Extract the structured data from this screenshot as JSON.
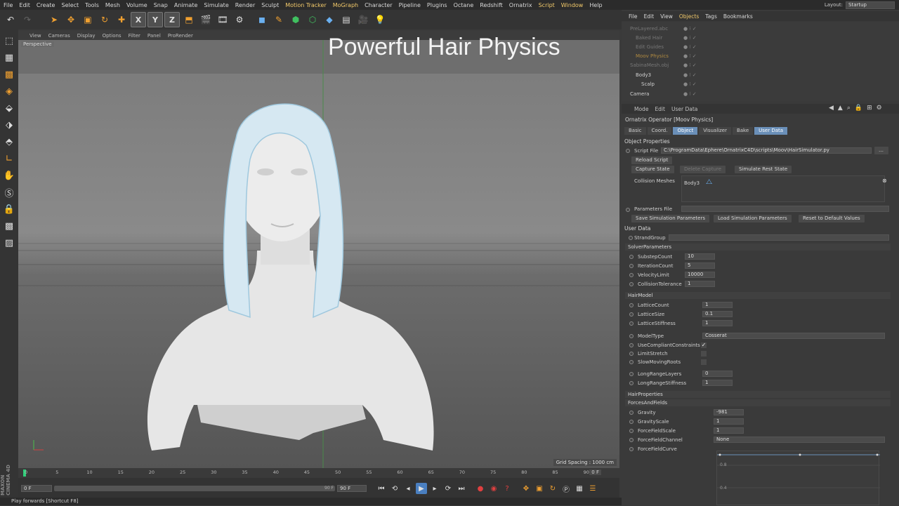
{
  "menubar": {
    "items": [
      "File",
      "Edit",
      "Create",
      "Select",
      "Tools",
      "Mesh",
      "Volume",
      "Snap",
      "Animate",
      "Simulate",
      "Render",
      "Sculpt",
      "Motion Tracker",
      "MoGraph",
      "Character",
      "Pipeline",
      "Plugins",
      "Octane",
      "Redshift",
      "Ornatrix",
      "Script",
      "Window",
      "Help"
    ],
    "highlighted": [
      "Motion Tracker",
      "MoGraph",
      "Script",
      "Window"
    ],
    "layout_label": "Layout:",
    "layout_value": "Startup"
  },
  "viewport": {
    "menu": [
      "View",
      "Cameras",
      "Display",
      "Options",
      "Filter",
      "Panel",
      "ProRender"
    ],
    "label": "Perspective",
    "overlay_title": "Powerful Hair Physics",
    "grid_spacing": "Grid Spacing : 1000 cm"
  },
  "timeline": {
    "ticks": [
      "0",
      "5",
      "10",
      "15",
      "20",
      "25",
      "30",
      "35",
      "40",
      "45",
      "50",
      "55",
      "60",
      "65",
      "70",
      "75",
      "80",
      "85",
      "90"
    ],
    "current_frame": "0 F",
    "start_field": "0 F",
    "end_field": "90 F",
    "end_field2": "90 F",
    "end_min": "0 F"
  },
  "status_text": "Play forwards [Shortcut F8]",
  "maxon_text": "MAXON CINEMA 4D",
  "object_manager": {
    "menu": [
      "File",
      "Edit",
      "View",
      "Objects",
      "Tags",
      "Bookmarks"
    ],
    "highlighted": [
      "Objects"
    ],
    "rows": [
      {
        "name": "PreLayered.abc",
        "indent": 0,
        "faded": true
      },
      {
        "name": "Baked Hair",
        "indent": 1,
        "faded": true
      },
      {
        "name": "Edit Guides",
        "indent": 1,
        "faded": true
      },
      {
        "name": "Moov Physics",
        "indent": 1,
        "faded": true,
        "accent": true
      },
      {
        "name": "SabinaMesh.obj",
        "indent": 0,
        "faded": true
      },
      {
        "name": "Body3",
        "indent": 1,
        "faded": false
      },
      {
        "name": "Scalp",
        "indent": 2,
        "faded": false
      },
      {
        "name": "Camera",
        "indent": 0,
        "faded": false
      }
    ]
  },
  "attribute_manager": {
    "menu": [
      "Mode",
      "Edit",
      "User Data"
    ],
    "title": "Ornatrix Operator [Moov Physics]",
    "tabs": [
      {
        "label": "Basic",
        "active": false
      },
      {
        "label": "Coord.",
        "active": false
      },
      {
        "label": "Object",
        "active": true
      },
      {
        "label": "Visualizer",
        "active": false
      },
      {
        "label": "Bake",
        "active": false
      },
      {
        "label": "User Data",
        "active": true
      }
    ],
    "object_properties": "Object Properties",
    "script_file_label": "Script File",
    "script_file_value": "C:\\ProgramData\\Ephere\\OrnatrixC4D\\scripts\\Moov\\HairSimulator.py",
    "reload_script": "Reload Script",
    "capture_state": "Capture State",
    "delete_capture": "Delete Capture",
    "simulate_rest_state": "Simulate Rest State",
    "collision_meshes_label": "Collision Meshes",
    "collision_meshes_value": "Body3",
    "parameters_file_label": "Parameters File",
    "save_sim_params": "Save Simulation Parameters",
    "load_sim_params": "Load Simulation Parameters",
    "reset_defaults": "Reset to Default Values",
    "user_data": "User Data",
    "strand_group": "StrandGroup",
    "solver_section": "SolverParameters",
    "solver": [
      {
        "label": "SubstepCount",
        "value": "10"
      },
      {
        "label": "IterationCount",
        "value": "5"
      },
      {
        "label": "VelocityLimit",
        "value": "10000"
      },
      {
        "label": "CollisionTolerance",
        "value": "1"
      }
    ],
    "hairmodel_section": "HairModel",
    "hairmodel": [
      {
        "label": "LatticeCount",
        "value": "1"
      },
      {
        "label": "LatticeSize",
        "value": "0.1"
      },
      {
        "label": "LatticeStiffness",
        "value": "1"
      }
    ],
    "model_type_label": "ModelType",
    "model_type_value": "Cosserat",
    "checks": [
      {
        "label": "UseCompliantConstraints",
        "checked": true
      },
      {
        "label": "LimitStretch",
        "checked": false
      },
      {
        "label": "SlowMovingRoots",
        "checked": false
      }
    ],
    "long_range": [
      {
        "label": "LongRangeLayers",
        "value": "0"
      },
      {
        "label": "LongRangeStiffness",
        "value": "1"
      }
    ],
    "hairproperties_section": "HairProperties",
    "forces_section": "ForcesAndFields",
    "forces": [
      {
        "label": "Gravity",
        "value": "-981"
      },
      {
        "label": "GravityScale",
        "value": "1"
      },
      {
        "label": "ForceFieldScale",
        "value": "1"
      }
    ],
    "forcefield_channel_label": "ForceFieldChannel",
    "forcefield_channel_value": "None",
    "forcefield_curve_label": "ForceFieldCurve",
    "curve_ticks": [
      "0.8",
      "0.4"
    ]
  }
}
